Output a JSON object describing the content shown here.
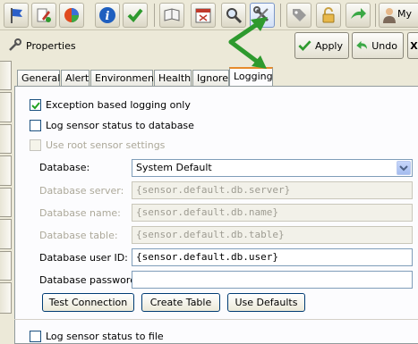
{
  "toolbar": {
    "user_label": "My",
    "icons": [
      "flag-icon",
      "edit-wrench-icon",
      "pie-chart-icon",
      "info-icon",
      "checkmark-icon",
      "notebook-icon",
      "calendar-icon",
      "magnifier-icon",
      "wrench-screwdriver-icon",
      "tag-icon",
      "padlock-icon",
      "green-arrow-icon",
      "user-icon"
    ]
  },
  "panel": {
    "title": "Properties",
    "apply_label": "Apply",
    "undo_label": "Undo",
    "close_label": "X"
  },
  "tabs": [
    {
      "label": "General"
    },
    {
      "label": "Alert"
    },
    {
      "label": "Environment"
    },
    {
      "label": "Health"
    },
    {
      "label": "Ignore"
    },
    {
      "label": "Logging",
      "active": true
    }
  ],
  "logging": {
    "exception_based": {
      "label": "Exception based logging only",
      "checked": true
    },
    "log_to_database": {
      "label": "Log sensor status to database",
      "checked": false
    },
    "use_root": {
      "label": "Use root sensor settings",
      "checked": false,
      "disabled": true
    },
    "database": {
      "label": "Database:",
      "value": "System Default"
    },
    "db_server": {
      "label": "Database server:",
      "value": "{sensor.default.db.server}"
    },
    "db_name": {
      "label": "Database name:",
      "value": "{sensor.default.db.name}"
    },
    "db_table": {
      "label": "Database table:",
      "value": "{sensor.default.db.table}"
    },
    "db_user": {
      "label": "Database user ID:",
      "value": "{sensor.default.db.user}"
    },
    "db_password": {
      "label": "Database password:",
      "value": ""
    },
    "test_connection_label": "Test Connection",
    "create_table_label": "Create Table",
    "use_defaults_label": "Use Defaults",
    "log_to_file": {
      "label": "Log sensor status to file",
      "checked": false
    }
  },
  "colors": {
    "active_tab_accent": "#e68b2c",
    "annotation_arrow": "#2e9a2e",
    "window_bg": "#ece9d8"
  }
}
